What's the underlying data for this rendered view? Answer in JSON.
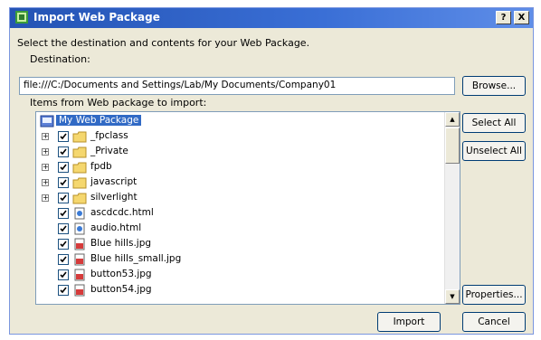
{
  "titlebar": {
    "title": "Import Web Package",
    "help_label": "?",
    "close_label": "X"
  },
  "instruction": "Select the destination and contents for your Web Package.",
  "destination": {
    "label": "Destination:",
    "value": "file:///C:/Documents and Settings/Lab/My Documents/Company01"
  },
  "buttons": {
    "browse": "Browse...",
    "select_all": "Select All",
    "unselect_all": "Unselect All",
    "properties": "Properties...",
    "import": "Import",
    "cancel": "Cancel"
  },
  "items_label": "Items from Web package to import:",
  "tree": {
    "root": "My Web Package",
    "folders": [
      "_fpclass",
      "_Private",
      "fpdb",
      "javascript",
      "silverlight"
    ],
    "files": [
      "ascdcdc.html",
      "audio.html",
      "Blue hills.jpg",
      "Blue hills_small.jpg",
      "button53.jpg",
      "button54.jpg"
    ]
  }
}
